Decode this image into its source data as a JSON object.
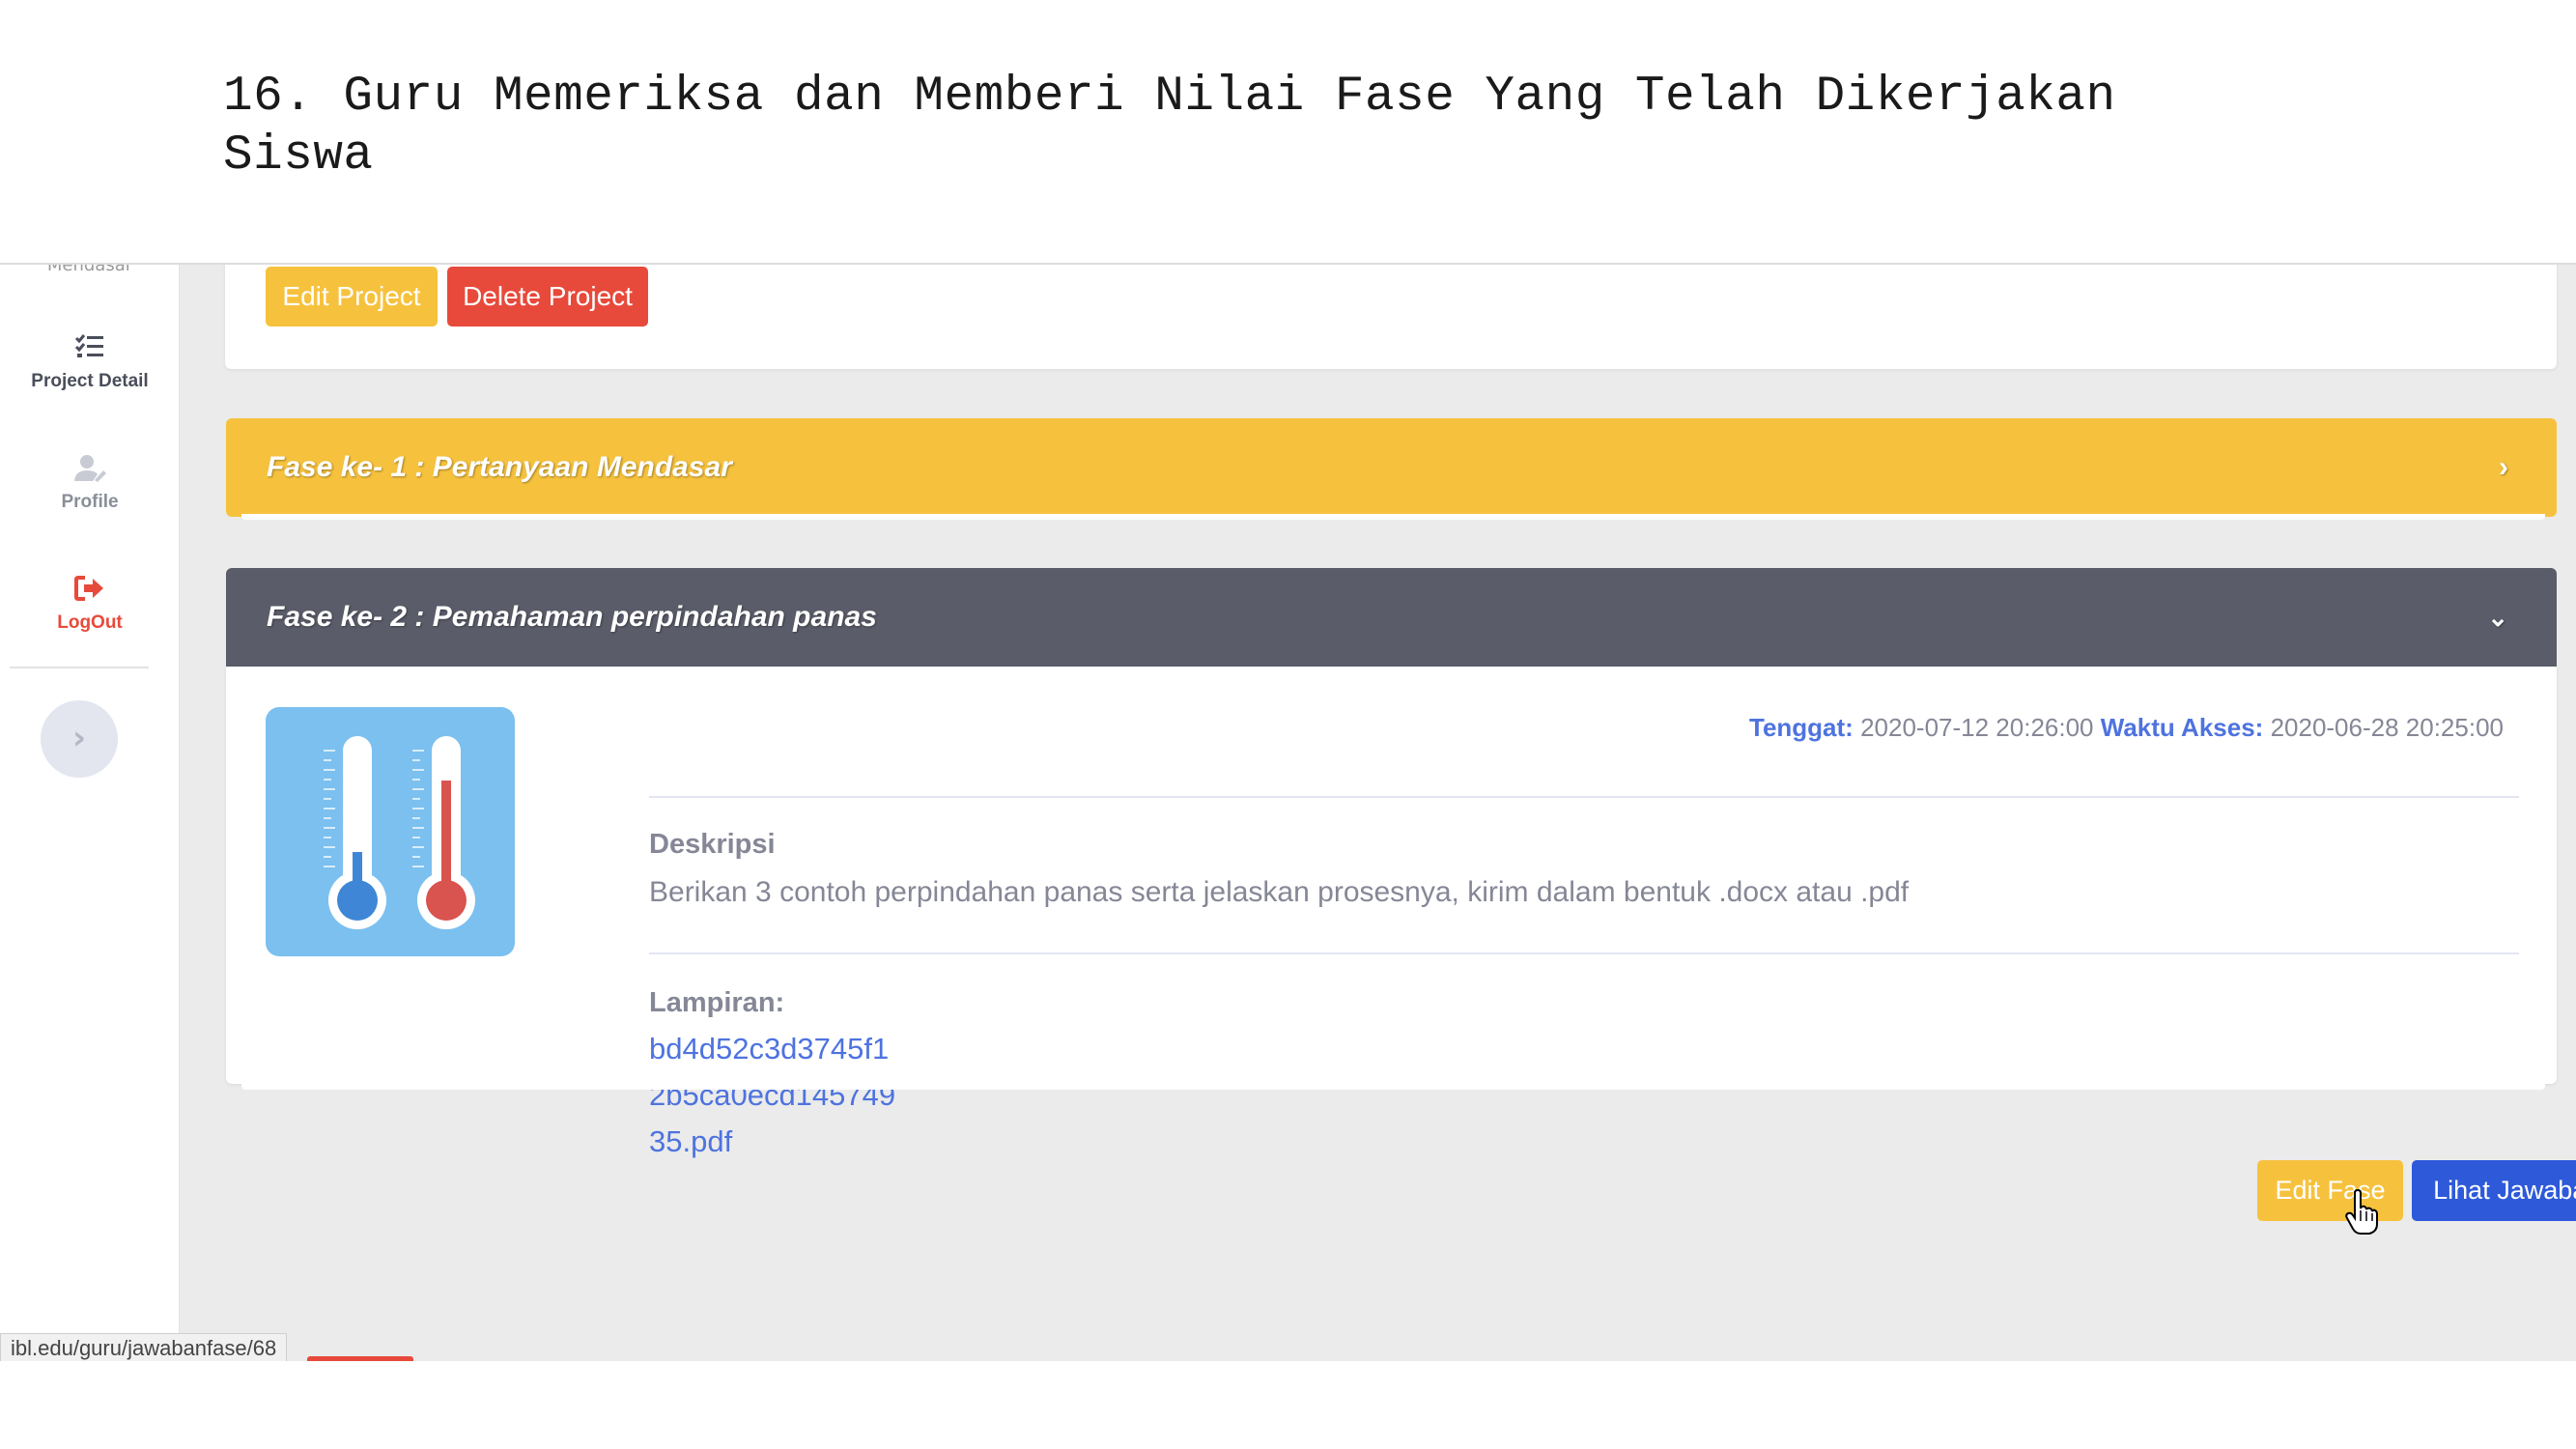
{
  "document": {
    "heading_line1": "16. Guru Memeriksa dan Memberi Nilai Fase Yang Telah Dikerjakan",
    "heading_line2": "Siswa"
  },
  "sidebar": {
    "cut_label": "Mendasar",
    "items": [
      {
        "label": "Project Detail",
        "icon": "list-check-icon"
      },
      {
        "label": "Profile",
        "icon": "user-edit-icon"
      },
      {
        "label": "LogOut",
        "icon": "sign-out-icon"
      }
    ],
    "toggle_icon": "chevron-right-icon"
  },
  "project_actions": {
    "edit_label": "Edit Project",
    "delete_label": "Delete Project"
  },
  "phases": [
    {
      "title": "Fase ke- 1 : Pertanyaan Mendasar",
      "state": "collapsed",
      "color": "#f6c23e"
    },
    {
      "title": "Fase ke- 2 : Pemahaman perpindahan panas",
      "state": "expanded",
      "color": "#5a5c69",
      "image": "thermometers-image",
      "deadline_label": "Tenggat:",
      "deadline_value": "2020-07-12 20:26:00",
      "access_label": "Waktu Akses:",
      "access_value": "2020-06-28 20:25:00",
      "description_title": "Deskripsi",
      "description_text": "Berikan 3 contoh perpindahan panas serta jelaskan prosesnya, kirim dalam bentuk .docx atau .pdf",
      "attachment_title": "Lampiran:",
      "attachment_lines": [
        "bd4d52c3d3745f1",
        "2b5ca0ecd145749",
        "35.pdf"
      ],
      "edit_phase_label": "Edit Fase",
      "view_answers_label": "Lihat Jawaban Kelompok"
    }
  ],
  "statusbar": {
    "url": "ibl.edu/guru/jawabanfase/68"
  },
  "colors": {
    "primary": "#4e73df",
    "warning": "#f6c23e",
    "danger": "#e74a3b",
    "dark": "#5a5c69",
    "background": "#ebebeb"
  }
}
